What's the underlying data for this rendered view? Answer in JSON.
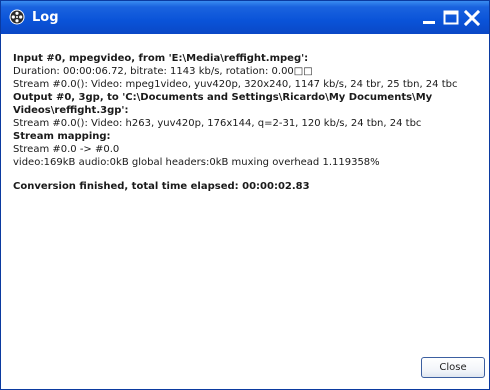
{
  "window": {
    "title": "Log"
  },
  "titlebar": {
    "app_icon": "film-reel-icon",
    "minimize_icon": "minimize-icon",
    "maximize_icon": "maximize-icon",
    "close_icon": "close-icon"
  },
  "log": {
    "lines": [
      "Input #0, mpegvideo, from 'E:\\Media\\reffight.mpeg':",
      "Duration: 00:00:06.72, bitrate: 1143 kb/s, rotation: 0.00□□",
      "Stream #0.0(): Video: mpeg1video, yuv420p, 320x240, 1147 kb/s, 24 tbr, 25 tbn, 24 tbc",
      "Output #0, 3gp, to 'C:\\Documents and Settings\\Ricardo\\My Documents\\My",
      "Videos\\reffight.3gp':",
      "Stream #0.0(): Video: h263, yuv420p, 176x144, q=2-31, 120 kb/s, 24 tbn, 24 tbc",
      "Stream mapping:",
      "Stream #0.0 -> #0.0",
      "video:169kB audio:0kB global headers:0kB muxing overhead 1.119358%",
      "Conversion finished, total time elapsed: 00:00:02.83"
    ]
  },
  "footer": {
    "close_label": "Close"
  },
  "colors": {
    "titlebar": "#0a53d8",
    "window_bg": "#ffffff",
    "text": "#1a1a1a"
  }
}
